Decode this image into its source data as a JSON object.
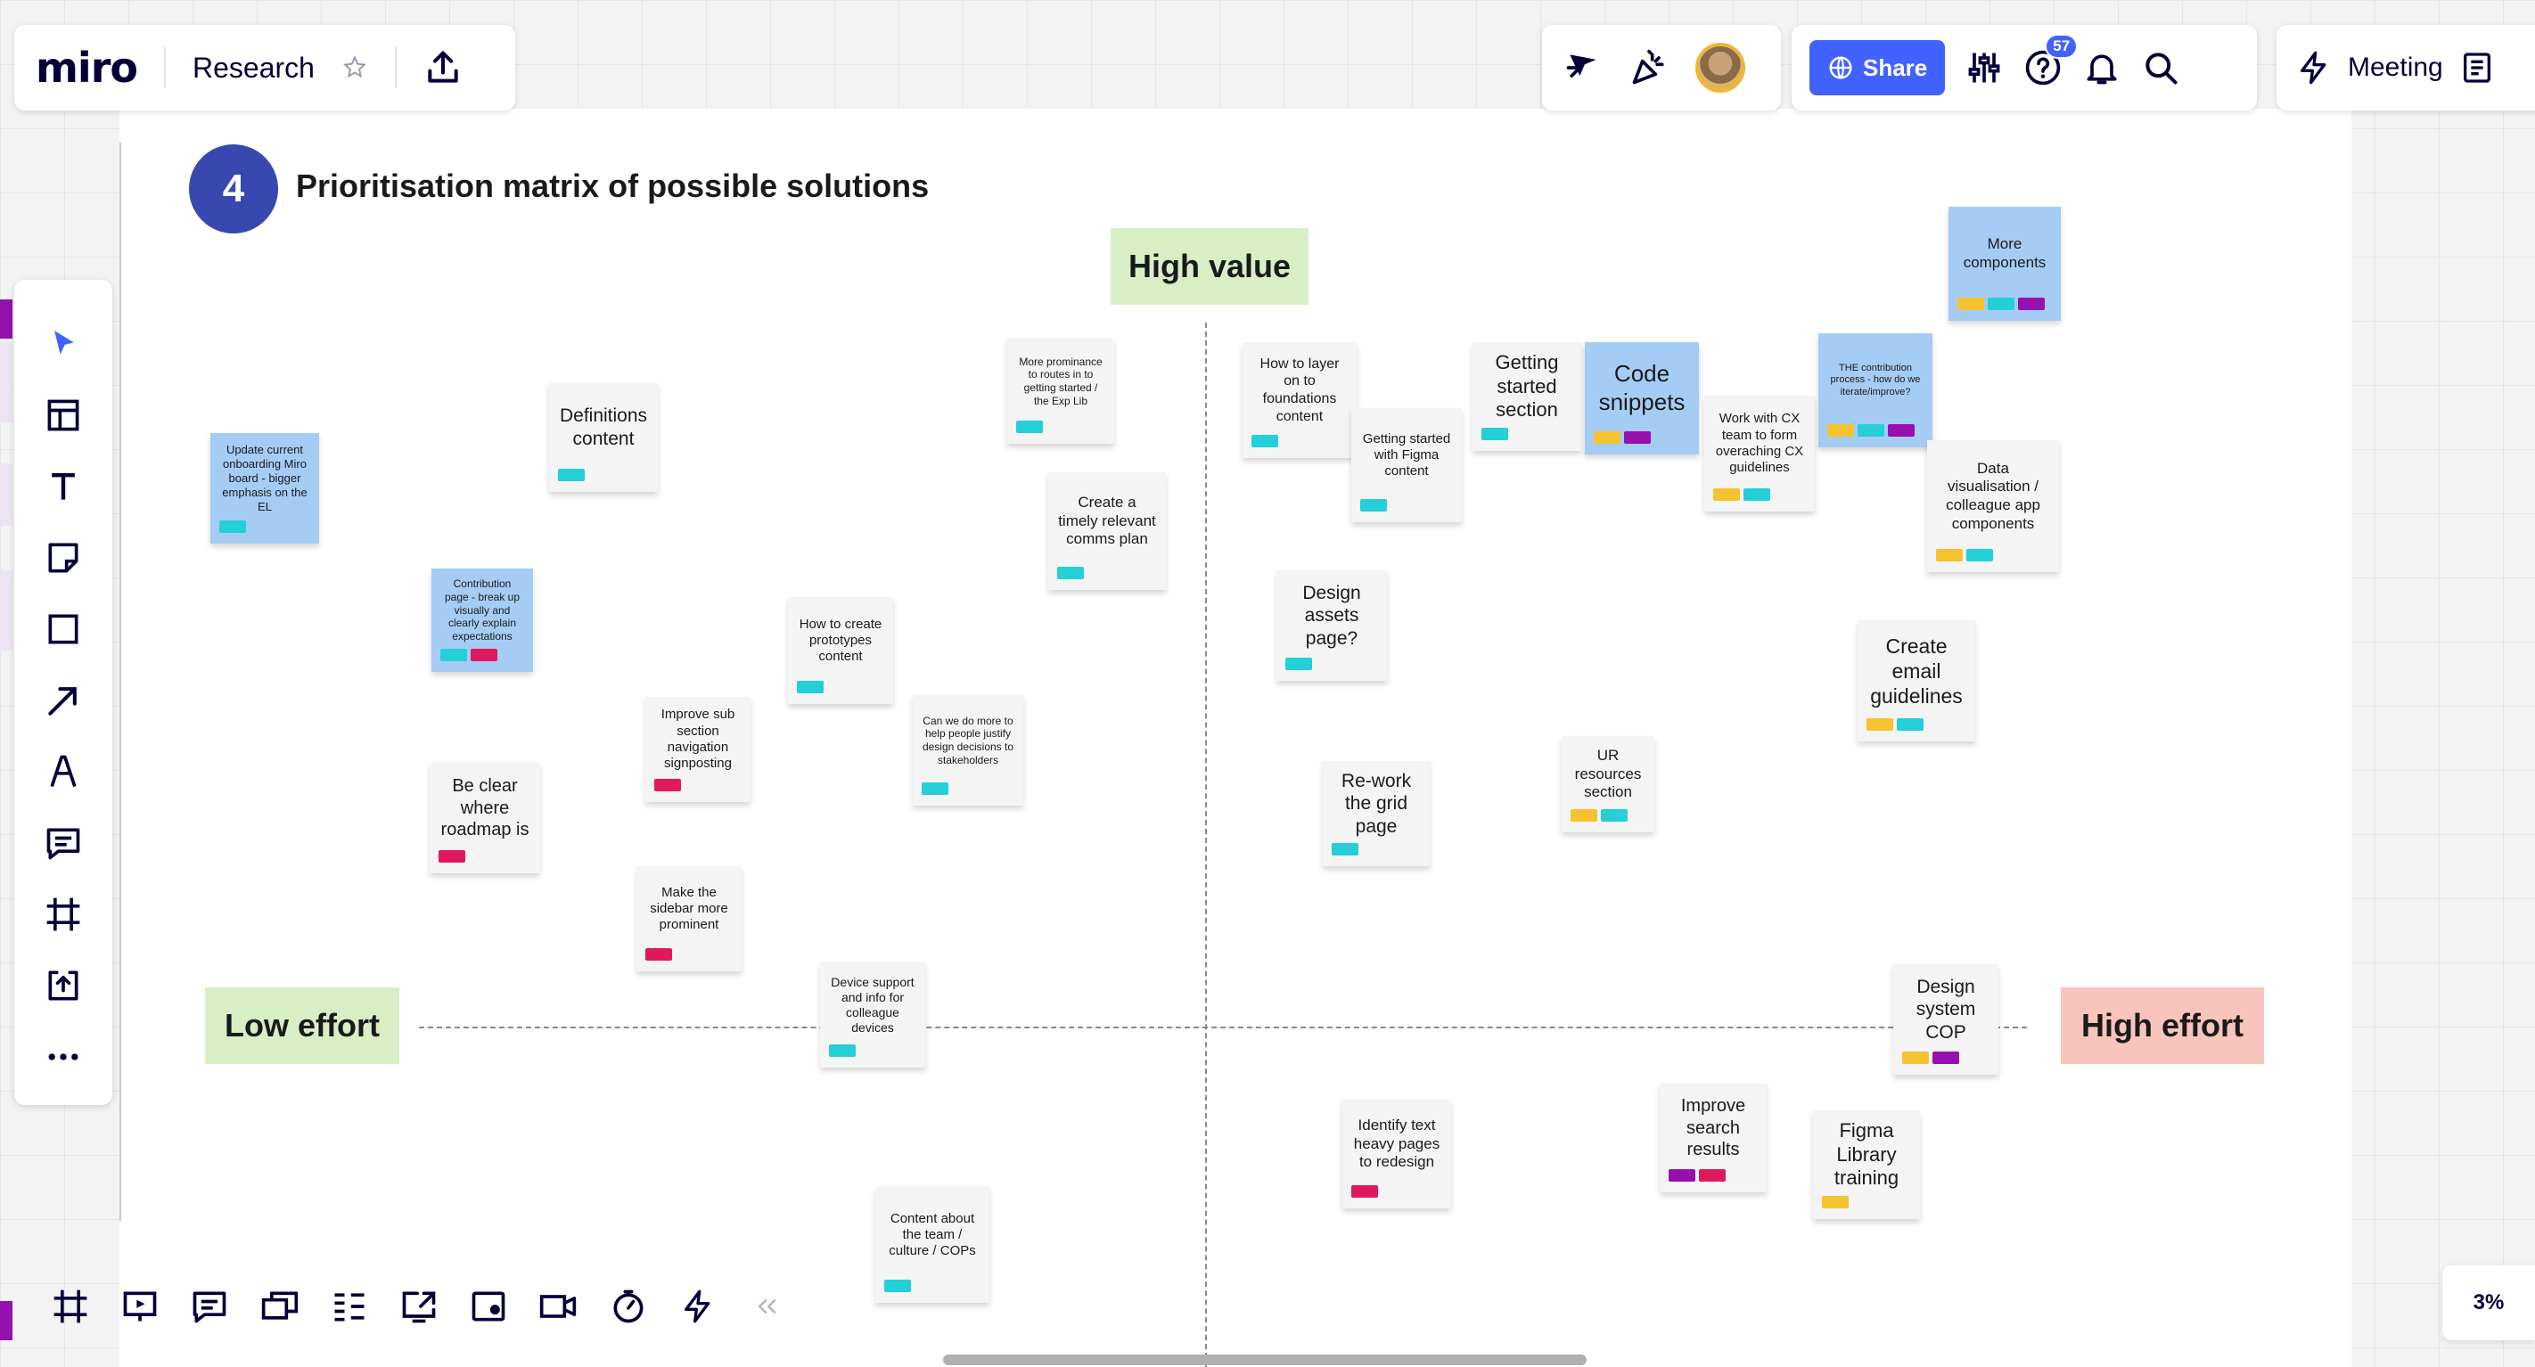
{
  "app": {
    "logo": "miro",
    "board_name": "Research",
    "share_label": "Share",
    "help_badge": "57",
    "meeting_label": "Meeting",
    "zoom_level": "3%"
  },
  "toolbar_left": [
    {
      "name": "select-tool-icon"
    },
    {
      "name": "templates-icon"
    },
    {
      "name": "text-tool-icon"
    },
    {
      "name": "sticky-note-icon"
    },
    {
      "name": "shape-tool-icon"
    },
    {
      "name": "connector-arrow-icon"
    },
    {
      "name": "pen-tool-icon"
    },
    {
      "name": "comment-icon"
    },
    {
      "name": "frame-tool-icon"
    },
    {
      "name": "upload-icon"
    },
    {
      "name": "more-tools-icon"
    }
  ],
  "toolbar_bottom": [
    {
      "name": "frames-icon"
    },
    {
      "name": "presentation-icon"
    },
    {
      "name": "comments-icon"
    },
    {
      "name": "cards-icon"
    },
    {
      "name": "kanban-icon"
    },
    {
      "name": "screen-share-icon"
    },
    {
      "name": "screen-record-icon"
    },
    {
      "name": "video-chat-icon"
    },
    {
      "name": "timer-icon"
    },
    {
      "name": "quick-actions-icon"
    }
  ],
  "matrix": {
    "step_number": "4",
    "title": "Prioritisation matrix of possible solutions",
    "top_label": "High value",
    "left_label": "Low effort",
    "right_label": "High effort",
    "colors": {
      "top": "#d8efc6",
      "left": "#d8efc6",
      "right": "#f8c4bb"
    }
  },
  "stickies": [
    {
      "text": "Update current onboarding Miro board - bigger emphasis on the EL",
      "color": "blue",
      "size": 13,
      "tags": [
        "cyan"
      ]
    },
    {
      "text": "Definitions content",
      "color": "grey",
      "size": 21,
      "tags": [
        "cyan"
      ]
    },
    {
      "text": "Contribution page - break up visually and clearly explain expectations",
      "color": "blue",
      "size": 12,
      "tags": [
        "cyan",
        "pink"
      ]
    },
    {
      "text": "More prominance to routes in to getting started / the Exp Lib",
      "color": "grey",
      "size": 12,
      "tags": [
        "cyan"
      ]
    },
    {
      "text": "Create a timely relevant comms plan",
      "color": "grey",
      "size": 17,
      "tags": [
        "cyan"
      ]
    },
    {
      "text": "How to create prototypes content",
      "color": "grey",
      "size": 15,
      "tags": [
        "cyan"
      ]
    },
    {
      "text": "Improve sub section navigation signposting",
      "color": "grey",
      "size": 15,
      "tags": [
        "pink"
      ]
    },
    {
      "text": "Can we do more to help people justify design decisions to stakeholders",
      "color": "grey",
      "size": 12,
      "tags": [
        "cyan"
      ]
    },
    {
      "text": "Be clear where roadmap is",
      "color": "grey",
      "size": 20,
      "tags": [
        "pink"
      ]
    },
    {
      "text": "Make the sidebar more prominent",
      "color": "grey",
      "size": 15,
      "tags": [
        "pink"
      ]
    },
    {
      "text": "Device support and info for colleague devices",
      "color": "grey",
      "size": 14,
      "tags": [
        "cyan"
      ]
    },
    {
      "text": "Content about the team / culture / COPs",
      "color": "grey",
      "size": 15,
      "tags": [
        "cyan"
      ]
    },
    {
      "text": "How to layer on to foundations content",
      "color": "grey",
      "size": 16,
      "tags": [
        "cyan"
      ]
    },
    {
      "text": "Getting started with Figma content",
      "color": "grey",
      "size": 15,
      "tags": [
        "cyan"
      ]
    },
    {
      "text": "Getting started section",
      "color": "grey",
      "size": 22,
      "tags": [
        "cyan"
      ]
    },
    {
      "text": "Code snippets",
      "color": "blue",
      "size": 26,
      "tags": [
        "yellow",
        "purple"
      ]
    },
    {
      "text": "Work with CX team to form overaching CX guidelines",
      "color": "grey",
      "size": 15,
      "tags": [
        "yellow",
        "cyan"
      ]
    },
    {
      "text": "THE contribution process - how do we iterate/improve?",
      "color": "blue",
      "size": 11,
      "tags": [
        "yellow",
        "cyan",
        "purple"
      ]
    },
    {
      "text": "More components",
      "color": "blue",
      "size": 17,
      "tags": [
        "yellow",
        "cyan",
        "purple"
      ]
    },
    {
      "text": "Data visualisation / colleague app components",
      "color": "grey",
      "size": 17,
      "tags": [
        "yellow",
        "cyan"
      ]
    },
    {
      "text": "Design assets page?",
      "color": "grey",
      "size": 21,
      "tags": [
        "cyan"
      ]
    },
    {
      "text": "Create email guidelines",
      "color": "grey",
      "size": 23,
      "tags": [
        "yellow",
        "cyan"
      ]
    },
    {
      "text": "UR resources section",
      "color": "grey",
      "size": 17,
      "tags": [
        "yellow",
        "cyan"
      ]
    },
    {
      "text": "Re-work the grid page",
      "color": "grey",
      "size": 21,
      "tags": [
        "cyan"
      ]
    },
    {
      "text": "Design system COP",
      "color": "grey",
      "size": 21,
      "tags": [
        "yellow",
        "purple"
      ]
    },
    {
      "text": "Identify text heavy pages to redesign",
      "color": "grey",
      "size": 17,
      "tags": [
        "pink"
      ]
    },
    {
      "text": "Improve search results",
      "color": "grey",
      "size": 20,
      "tags": [
        "purple",
        "pink"
      ]
    },
    {
      "text": "Figma Library training",
      "color": "grey",
      "size": 22,
      "tags": [
        "yellow"
      ]
    }
  ]
}
